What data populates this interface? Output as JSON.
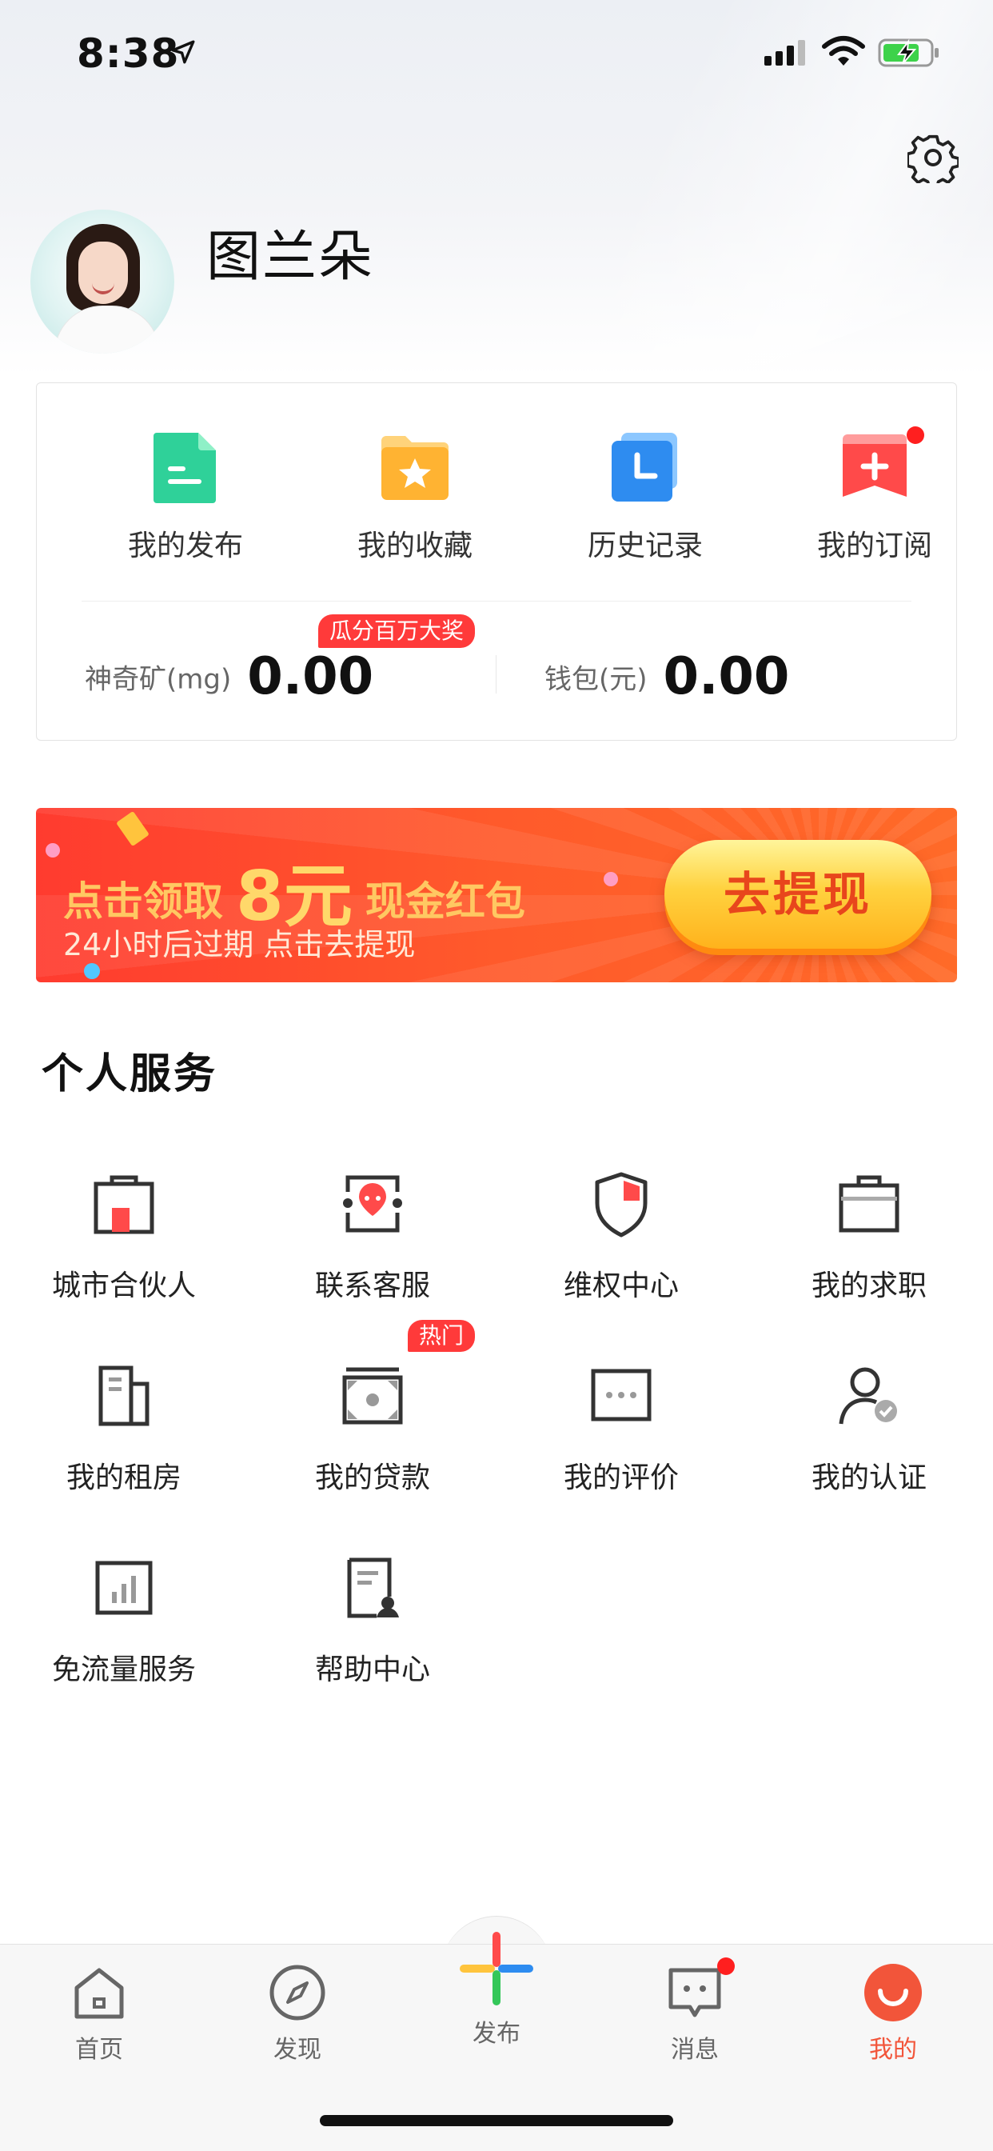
{
  "status_bar": {
    "time": "8:38"
  },
  "profile": {
    "username": "图兰朵"
  },
  "quick_actions": [
    {
      "label": "我的发布",
      "icon": "document-icon",
      "color": "#2fd199"
    },
    {
      "label": "我的收藏",
      "icon": "folder-star-icon",
      "color": "#ffb332"
    },
    {
      "label": "历史记录",
      "icon": "clock-icon",
      "color": "#2e8cf0"
    },
    {
      "label": "我的订阅",
      "icon": "subscribe-plus-icon",
      "color": "#ff4a4a"
    }
  ],
  "stats": {
    "minerals_label": "神奇矿(mg)",
    "minerals_value": "0.00",
    "minerals_badge": "瓜分百万大奖",
    "wallet_label": "钱包(元)",
    "wallet_value": "0.00"
  },
  "banner": {
    "title_prefix": "点击领取",
    "title_amount": "8元",
    "title_suffix": "现金红包",
    "subtitle": "24小时后过期   点击去提现",
    "button_label": "去提现"
  },
  "services": {
    "title": "个人服务",
    "hot_badge": "热门",
    "items": [
      {
        "label": "城市合伙人",
        "icon": "store-icon"
      },
      {
        "label": "联系客服",
        "icon": "customer-service-icon"
      },
      {
        "label": "维权中心",
        "icon": "shield-icon"
      },
      {
        "label": "我的求职",
        "icon": "briefcase-icon"
      },
      {
        "label": "我的租房",
        "icon": "building-icon"
      },
      {
        "label": "我的贷款",
        "icon": "money-icon"
      },
      {
        "label": "我的评价",
        "icon": "rating-icon"
      },
      {
        "label": "我的认证",
        "icon": "user-verified-icon"
      },
      {
        "label": "免流量服务",
        "icon": "bar-chart-icon"
      },
      {
        "label": "帮助中心",
        "icon": "help-document-icon"
      }
    ]
  },
  "tabbar": {
    "items": [
      {
        "label": "首页",
        "icon": "home-icon"
      },
      {
        "label": "发现",
        "icon": "compass-icon"
      },
      {
        "label": "发布",
        "icon": "plus-icon"
      },
      {
        "label": "消息",
        "icon": "message-icon"
      },
      {
        "label": "我的",
        "icon": "profile-icon"
      }
    ],
    "active": "我的",
    "active_color": "#f2553a"
  }
}
